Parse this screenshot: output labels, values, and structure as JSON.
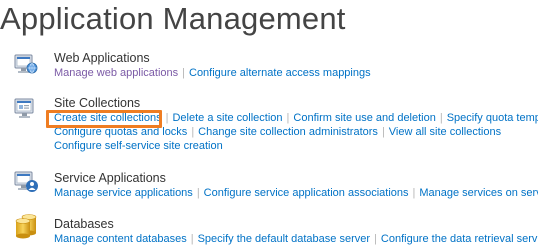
{
  "page": {
    "title": "Application Management"
  },
  "sections": {
    "web_applications": {
      "title": "Web Applications",
      "icon": "web-applications-icon",
      "links": [
        "Manage web applications",
        "Configure alternate access mappings"
      ]
    },
    "site_collections": {
      "title": "Site Collections",
      "icon": "site-collections-icon",
      "links": [
        "Create site collections",
        "Delete a site collection",
        "Confirm site use and deletion",
        "Specify quota templates",
        "Configure quotas and locks",
        "Change site collection administrators",
        "View all site collections",
        "Configure self-service site creation"
      ]
    },
    "service_applications": {
      "title": "Service Applications",
      "icon": "service-applications-icon",
      "links": [
        "Manage service applications",
        "Configure service application associations",
        "Manage services on server"
      ]
    },
    "databases": {
      "title": "Databases",
      "icon": "databases-icon",
      "links": [
        "Manage content databases",
        "Specify the default database server",
        "Configure the data retrieval service"
      ]
    }
  },
  "colors": {
    "link": "#0072c6",
    "visited_link": "#7b5aa6",
    "highlight": "#ef7d22",
    "title": "#444444"
  }
}
